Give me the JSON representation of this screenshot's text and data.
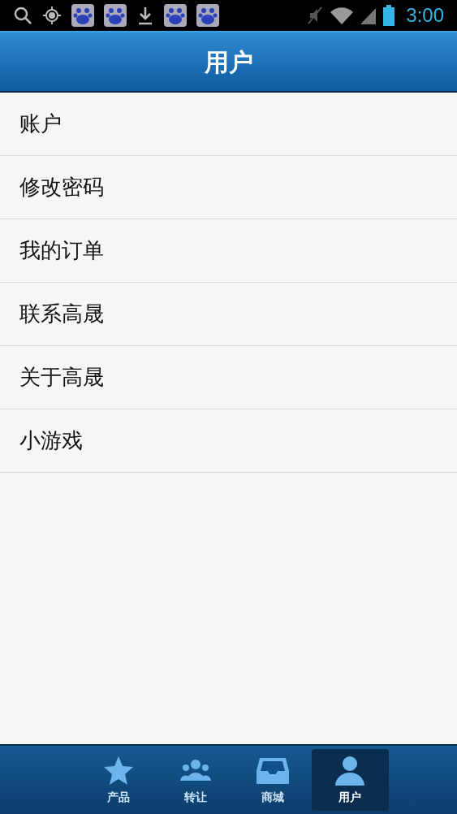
{
  "status_bar": {
    "time": "3:00"
  },
  "header": {
    "title": "用户"
  },
  "menu": [
    {
      "label": "账户"
    },
    {
      "label": "修改密码"
    },
    {
      "label": "我的订单"
    },
    {
      "label": "联系高晟"
    },
    {
      "label": "关于高晟"
    },
    {
      "label": "小游戏"
    }
  ],
  "tab_bar": [
    {
      "label": "产品",
      "kind": "star",
      "selected": false
    },
    {
      "label": "转让",
      "kind": "people",
      "selected": false
    },
    {
      "label": "商城",
      "kind": "tray",
      "selected": false
    },
    {
      "label": "用户",
      "kind": "person",
      "selected": true
    }
  ]
}
